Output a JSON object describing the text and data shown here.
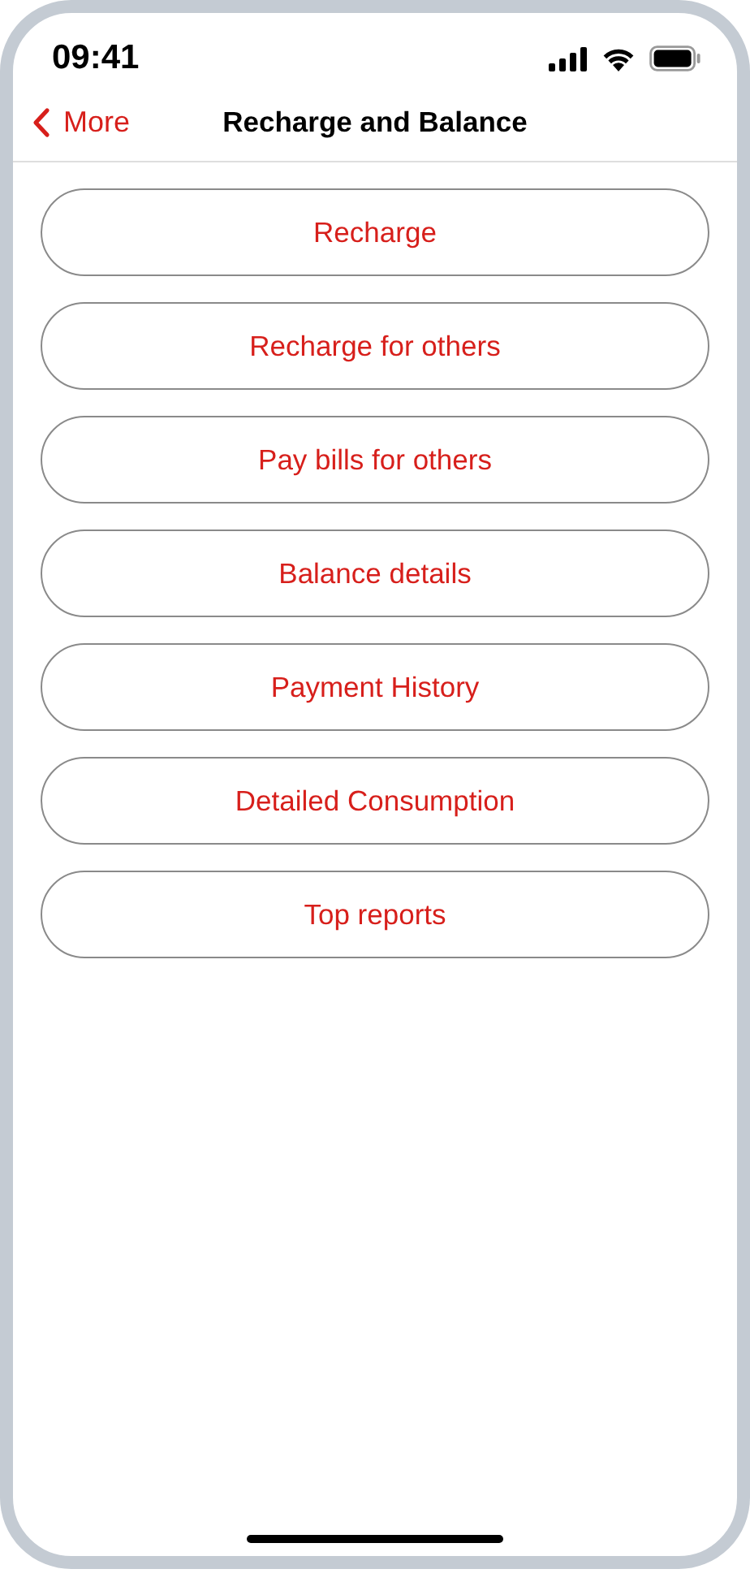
{
  "status_bar": {
    "time": "09:41"
  },
  "nav": {
    "back_label": "More",
    "title": "Recharge and Balance"
  },
  "menu": [
    {
      "label": "Recharge"
    },
    {
      "label": "Recharge for others"
    },
    {
      "label": "Pay bills for others"
    },
    {
      "label": "Balance details"
    },
    {
      "label": "Payment History"
    },
    {
      "label": "Detailed Consumption"
    },
    {
      "label": "Top reports"
    }
  ]
}
